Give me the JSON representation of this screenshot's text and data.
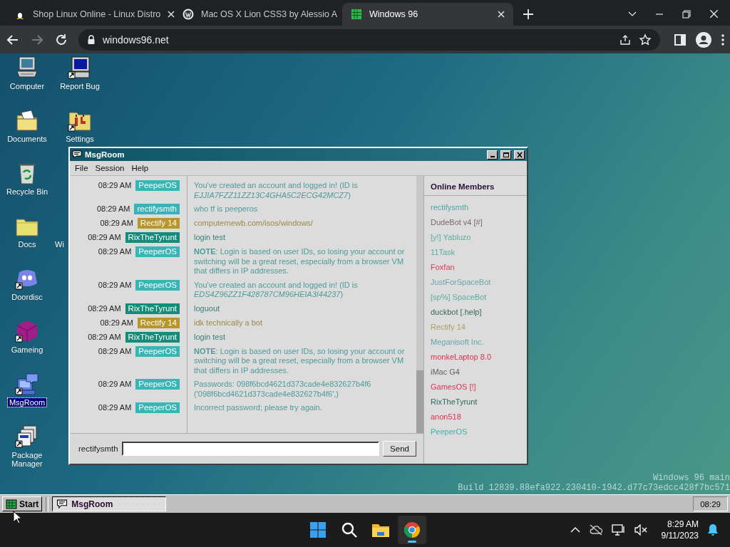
{
  "browser": {
    "tabs": [
      {
        "title": "Shop Linux Online - Linux Distro",
        "selected": false
      },
      {
        "title": "Mac OS X Lion CSS3 by Alessio A",
        "selected": false
      },
      {
        "title": "Windows 96",
        "selected": true
      }
    ],
    "address": "windows96.net"
  },
  "desktop": {
    "icons": [
      {
        "label": "Computer",
        "shortcut": false,
        "selected": false
      },
      {
        "label": "Documents",
        "shortcut": false,
        "selected": false
      },
      {
        "label": "Recycle Bin",
        "shortcut": false,
        "selected": false
      },
      {
        "label": "Docs",
        "shortcut": false,
        "selected": false
      },
      {
        "label": "Doordisc",
        "shortcut": true,
        "selected": false
      },
      {
        "label": "Gameing",
        "shortcut": true,
        "selected": false
      },
      {
        "label": "MsgRoom",
        "shortcut": true,
        "selected": true
      },
      {
        "label": "Package Manager",
        "shortcut": true,
        "selected": false
      },
      {
        "label": "Report Bug",
        "shortcut": true,
        "selected": false
      },
      {
        "label": "Settings",
        "shortcut": true,
        "selected": false
      },
      {
        "label": "Wi",
        "selected": false
      }
    ],
    "build_info": [
      "Windows 96 main",
      "Build 12839.88efa922.230410-1942.d77c73edcc428f7bc571"
    ]
  },
  "window": {
    "title": "MsgRoom",
    "menu": [
      "File",
      "Session",
      "Help"
    ],
    "messages": [
      {
        "time": "08:29 AM",
        "user": "PeeperOS",
        "color": "#38b5b5",
        "text": "You've created an account and logged in! (ID is *EJJIA7FZZ11ZZ13C4GHA5C2ECG42MCZ7*)"
      },
      {
        "time": "08:29 AM",
        "user": "rectifysmth",
        "color": "#3ab3b8",
        "text": "who tf is peeperos"
      },
      {
        "time": "08:29 AM",
        "user": "Rectify 14",
        "color": "#b8962a",
        "text": "computernewb.com/isos/windows/"
      },
      {
        "time": "08:29 AM",
        "user": "RixTheTyrunt",
        "color": "#158c7a",
        "text": "login test"
      },
      {
        "time": "08:29 AM",
        "user": "PeeperOS",
        "color": "#38b5b5",
        "text": "**NOTE**: Login is based on user IDs, so losing your account or switching will be a great reset, especially from a browser VM that differs in IP addresses."
      },
      {
        "time": "08:29 AM",
        "user": "PeeperOS",
        "color": "#38b5b5",
        "text": "You've created an account and logged in! (ID is *EDS4Z96ZZ1F428787CM96HEIA3I44237*)"
      },
      {
        "time": "08:29 AM",
        "user": "RixTheTyrunt",
        "color": "#158c7a",
        "text": "loguout"
      },
      {
        "time": "08:29 AM",
        "user": "Rectify 14",
        "color": "#b8962a",
        "text": "idk technically a bot"
      },
      {
        "time": "08:29 AM",
        "user": "RixTheTyrunt",
        "color": "#158c7a",
        "text": "login test"
      },
      {
        "time": "08:29 AM",
        "user": "PeeperOS",
        "color": "#38b5b5",
        "text": "**NOTE**: Login is based on user IDs, so losing your account or switching will be a great reset, especially from a browser VM that differs in IP addresses."
      },
      {
        "time": "08:29 AM",
        "user": "PeeperOS",
        "color": "#38b5b5",
        "text": "Passwords: 098f6bcd4621d373cade4e832627b4f6 ('098f6bcd4621d373cade4e832627b4f6',)"
      },
      {
        "time": "08:29 AM",
        "user": "PeeperOS",
        "color": "#38b5b5",
        "text": "Incorrect password; please try again."
      }
    ],
    "members_title": "Online Members",
    "members": [
      {
        "name": "rectifysmth",
        "color": "#4aa8a8"
      },
      {
        "name": "DudeBot v4 [#]",
        "color": "#7a6868"
      },
      {
        "name": "[y!] Yabluzo",
        "color": "#5aaea0"
      },
      {
        "name": "11Task",
        "color": "#5aaea0"
      },
      {
        "name": "Foxfan",
        "color": "#e03c58"
      },
      {
        "name": "JustForSpaceBot",
        "color": "#6aa6ae"
      },
      {
        "name": "[sp%] SpaceBot",
        "color": "#5aaea0"
      },
      {
        "name": "duckbot [.help]",
        "color": "#3a6658"
      },
      {
        "name": "Rectify 14",
        "color": "#aea05e"
      },
      {
        "name": "Meganisoft Inc.",
        "color": "#60a6ae"
      },
      {
        "name": "monkeLaptop 8.0",
        "color": "#e03050"
      },
      {
        "name": "iMac G4",
        "color": "#606060"
      },
      {
        "name": "GamesOS [!]",
        "color": "#e03050"
      },
      {
        "name": "RixTheTyrunt",
        "color": "#2a6a5a"
      },
      {
        "name": "anon518",
        "color": "#e03050"
      },
      {
        "name": "PeeperOS",
        "color": "#40b0b0"
      }
    ],
    "username": "rectifysmth",
    "send_button": "Send"
  },
  "taskbar": {
    "start": "Start",
    "tasks": [
      {
        "label": "MsgRoom",
        "selected": true
      }
    ],
    "clock": "08:29"
  },
  "system_taskbar": {
    "apps": [
      {
        "kind": "start",
        "selected": false
      },
      {
        "kind": "search",
        "selected": false
      },
      {
        "kind": "files",
        "selected": false
      },
      {
        "kind": "browser",
        "selected": true
      }
    ],
    "time": "8:29 AM",
    "date": "9/11/2023"
  }
}
